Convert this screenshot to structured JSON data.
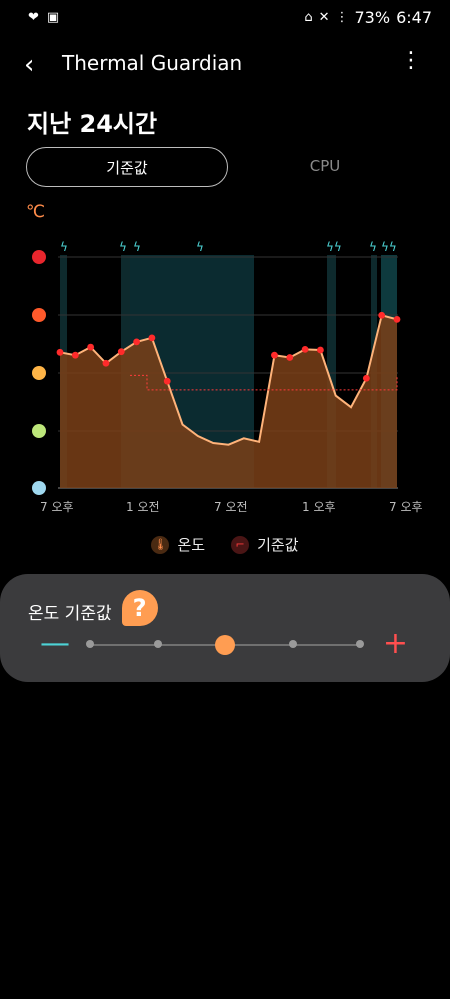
{
  "statusbar": {
    "left_icons": [
      "heart-icon",
      "image-icon"
    ],
    "battery": "73%",
    "time": "6:47"
  },
  "appbar": {
    "title": "Thermal Guardian"
  },
  "period": "지난 24시간",
  "segments": {
    "active": "기준값",
    "inactive": "CPU"
  },
  "unit": "℃",
  "chart_data": {
    "type": "area",
    "x_ticks": [
      "7 오후",
      "1 오전",
      "7 오전",
      "1 오후",
      "7 오후"
    ],
    "y_levels": [
      "very-hot-emoji",
      "hot-emoji",
      "warm-emoji",
      "cool-emoji",
      "cold-emoji"
    ],
    "series": [
      {
        "name": "온도",
        "values": [
          2.35,
          2.3,
          2.44,
          2.16,
          2.36,
          2.53,
          2.6,
          1.85,
          1.1,
          0.9,
          0.78,
          0.75,
          0.86,
          0.8,
          2.3,
          2.26,
          2.4,
          2.39,
          1.6,
          1.4,
          1.9,
          2.99,
          2.92
        ]
      },
      {
        "name": "기준값",
        "values": [
          1.95,
          1.95,
          1.7,
          1.7,
          1.7,
          1.7,
          1.7
        ]
      }
    ],
    "ylim": [
      0,
      4
    ]
  },
  "legend": [
    {
      "label": "온도",
      "color": "#ff8c4a"
    },
    {
      "label": "기준값",
      "color": "#ff3b3b"
    }
  ],
  "threshold": {
    "title": "온도 기준값",
    "help": "?",
    "steps": 5,
    "selected_index": 2,
    "minus": "—",
    "plus": "+"
  }
}
